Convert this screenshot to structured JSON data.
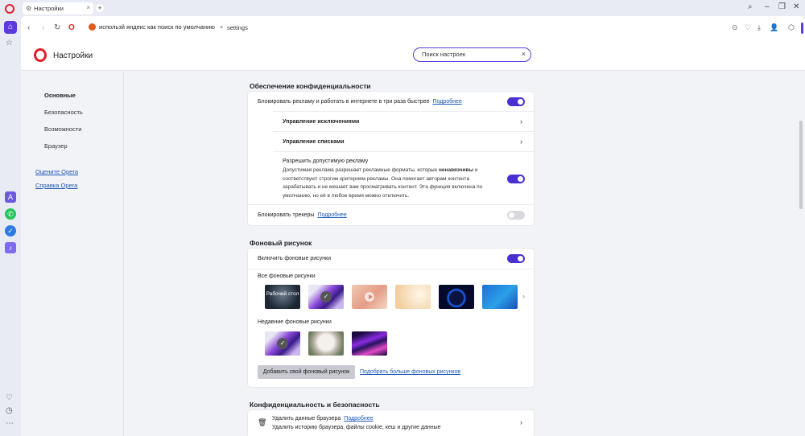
{
  "tab": {
    "title": "Настройки"
  },
  "addressbar": {
    "search_notice": "использй яндекс как поиск по умолчанию",
    "close_symbol": "×",
    "url": "settings"
  },
  "header": {
    "title": "Настройки",
    "search_value": "Поиск настроек",
    "search_clear": "×"
  },
  "nav": {
    "items": [
      "Основные",
      "Безопасность",
      "Возможности",
      "Браузер"
    ],
    "links": [
      "Оцените Opera",
      "Справка Opera"
    ]
  },
  "privacy": {
    "title": "Обеспечение конфиденциальности",
    "block_ads_label": "Блокировать рекламу и работать в интернете в три раза быстрее",
    "block_ads_link": "Подробнее",
    "block_ads_on": true,
    "manage_exceptions": "Управление исключениями",
    "manage_lists": "Управление списками",
    "acceptable_ads_title": "Разрешить допустимую рекламу",
    "acceptable_ads_desc_1": "Допустимая реклама разрешает рекламные форматы, которые",
    "acceptable_ads_desc_bold": "ненавязчивы",
    "acceptable_ads_desc_2": "и",
    "acceptable_ads_desc_3": "соответствуют строгим критериям рекламы. Она помогает авторам контента",
    "acceptable_ads_desc_4": "зарабатывать и не мешает вам просматривать контент. Эта функция включена по",
    "acceptable_ads_desc_5": "умолчанию, но её в любое время можно отключить.",
    "acceptable_ads_on": true,
    "block_trackers_label": "Блокировать трекеры",
    "block_trackers_link": "Подробнее",
    "block_trackers_on": false
  },
  "wallpaper": {
    "title": "Фоновый рисунок",
    "enable_label": "Включить фоновые рисунки",
    "enable_on": true,
    "all_label": "Все фоновые рисунки",
    "desktop_thumb_label": "Рабочий стол",
    "recent_label": "Недавние фоновые рисунки",
    "add_button": "Добавить свой фоновый рисунок",
    "more_link": "Подобрать больше фоновых рисунков"
  },
  "security": {
    "title": "Конфиденциальность и безопасность",
    "clear_data_label": "Удалить данные браузера",
    "clear_data_link": "Подробнее",
    "clear_data_desc": "Удалить историю браузера, файлы cookie, кеш и другие данные"
  },
  "colors": {
    "accent": "#4a2fd1",
    "opera_red": "#e0202a",
    "link": "#1a57b8"
  }
}
